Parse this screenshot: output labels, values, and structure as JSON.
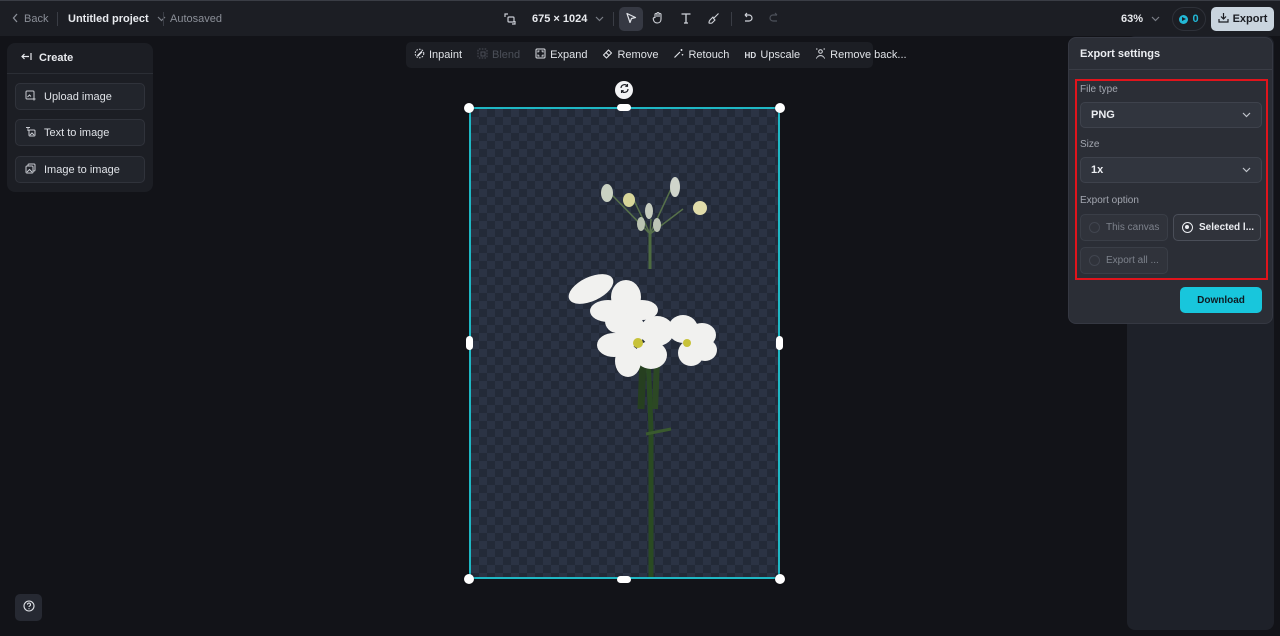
{
  "topbar": {
    "back_label": "Back",
    "project_title": "Untitled project",
    "save_status": "Autosaved",
    "canvas_size": "675 × 1024",
    "tools": [
      {
        "name": "select",
        "icon": "cursor-arrow-icon",
        "active": true
      },
      {
        "name": "hand",
        "icon": "hand-icon",
        "active": false
      },
      {
        "name": "text",
        "icon": "text-icon",
        "active": false
      },
      {
        "name": "brush",
        "icon": "brush-icon",
        "active": false
      },
      {
        "name": "undo",
        "icon": "undo-icon",
        "active": false
      },
      {
        "name": "redo",
        "icon": "redo-icon",
        "active": false,
        "disabled": true
      }
    ],
    "zoom_level": "63%",
    "credits": "0",
    "export_label": "Export"
  },
  "create_panel": {
    "title": "Create",
    "items": [
      {
        "label": "Upload image",
        "icon": "upload-image-icon"
      },
      {
        "label": "Text to image",
        "icon": "text-to-image-icon"
      },
      {
        "label": "Image to image",
        "icon": "image-to-image-icon"
      }
    ]
  },
  "edit_strip": {
    "items": [
      {
        "label": "Inpaint",
        "icon": "inpaint-icon",
        "disabled": false
      },
      {
        "label": "Blend",
        "icon": "blend-icon",
        "disabled": true
      },
      {
        "label": "Expand",
        "icon": "expand-icon",
        "disabled": false
      },
      {
        "label": "Remove",
        "icon": "eraser-icon",
        "disabled": false
      },
      {
        "label": "Retouch",
        "icon": "magic-wand-icon",
        "disabled": false
      },
      {
        "label": "Upscale",
        "icon": "hd-icon",
        "icon_text": "HD",
        "disabled": false
      },
      {
        "label": "Remove back...",
        "icon": "remove-background-icon",
        "disabled": false
      }
    ]
  },
  "export_settings": {
    "title": "Export settings",
    "file_type_label": "File type",
    "file_type_value": "PNG",
    "size_label": "Size",
    "size_value": "1x",
    "export_option_label": "Export option",
    "options": [
      {
        "label": "This canvas",
        "selected": false
      },
      {
        "label": "Selected l...",
        "selected": true
      },
      {
        "label": "Export all ...",
        "selected": false
      }
    ],
    "download_label": "Download"
  },
  "colors": {
    "accent": "#18c6dc",
    "selection": "#1fb7c4",
    "highlight_box": "#e0141c",
    "background": "#121318"
  }
}
